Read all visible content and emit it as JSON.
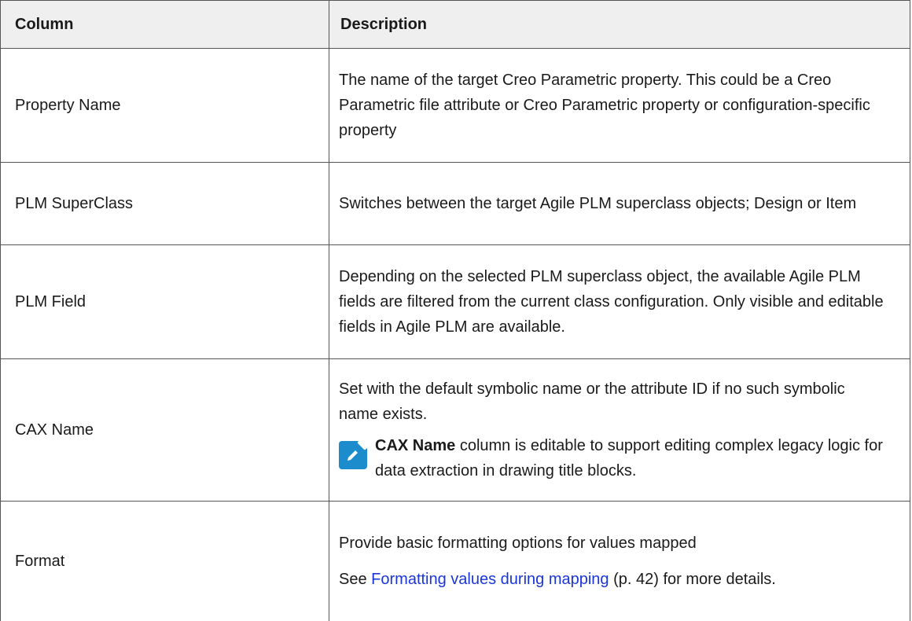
{
  "headers": {
    "column": "Column",
    "description": "Description"
  },
  "rows": [
    {
      "column": "Property Name",
      "description": "The name of the target Creo Parametric property. This could be a Creo Parametric file attribute or Creo Parametric property or configuration-specific property"
    },
    {
      "column": "PLM SuperClass",
      "description": "Switches between the target Agile PLM superclass objects; Design or Item"
    },
    {
      "column": "PLM Field",
      "description": "Depending on the selected PLM superclass object, the available Agile PLM fields are filtered from the current class configuration. Only visible and editable fields in Agile PLM are available."
    },
    {
      "column": "CAX Name",
      "description": "Set with the default symbolic name or the attribute ID if no such symbolic name exists.",
      "note": {
        "icon": "edit-note-icon",
        "bold": "CAX Name",
        "text": " column is editable to support editing complex legacy logic for data extraction in drawing title blocks."
      }
    },
    {
      "column": "Format",
      "description": "Provide basic formatting options for values mapped",
      "see_prefix": "See ",
      "link_text": "Formatting values during mapping",
      "see_suffix": " (p. 42) for more details."
    }
  ],
  "colors": {
    "header_bg": "#efefef",
    "note_icon": "#1c8ccc",
    "link": "#1a36d9"
  }
}
